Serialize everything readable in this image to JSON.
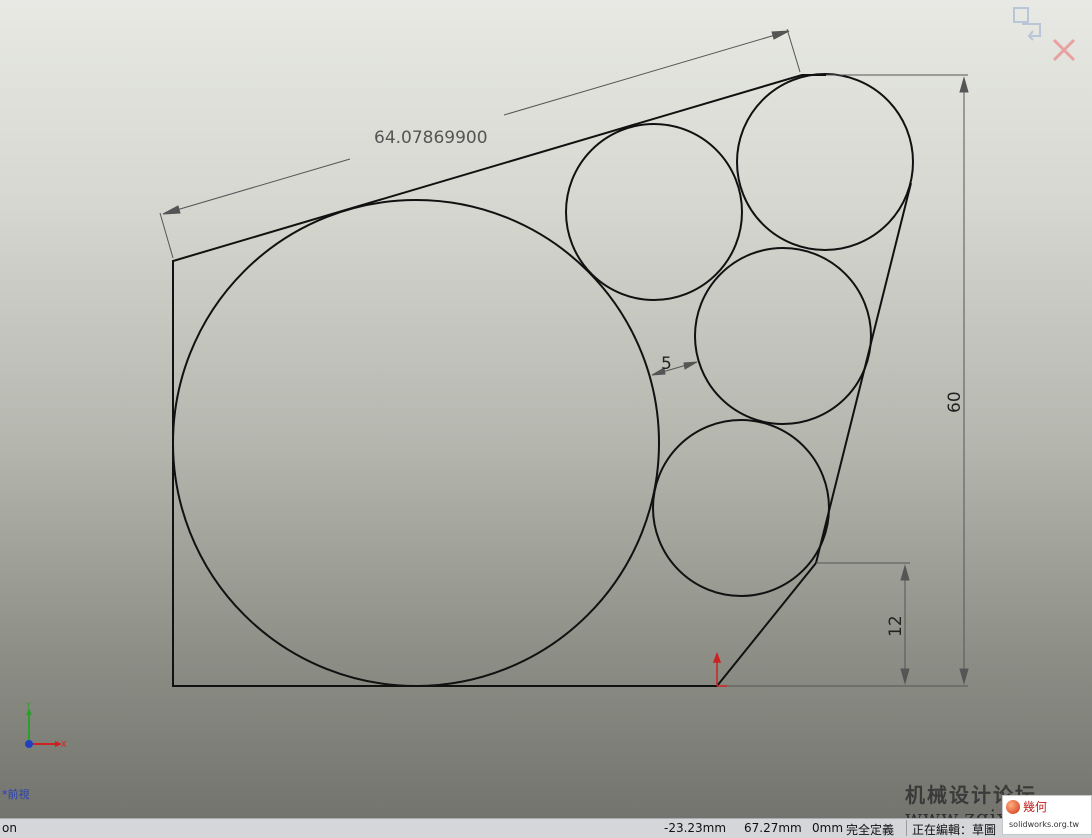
{
  "dimensions": {
    "slanted_length": "64.07869900",
    "gap": "5",
    "total_height": "60",
    "lower_height": "12"
  },
  "view": {
    "label": "*前視"
  },
  "status_bar": {
    "left_fragment": "on",
    "x_coord": "-23.23mm",
    "y_coord": "67.27mm",
    "z_coord": "0mm",
    "sketch_state": "完全定義",
    "editing": "正在編輯：草圖"
  },
  "watermark": {
    "forum_name": "机械设计论坛",
    "forum_url": "www.zgjxcad.com",
    "badge_title": "幾何",
    "badge_url": "solidworks.org.tw"
  },
  "icons": {
    "confirm": "confirm-sketch-icon",
    "cancel": "cancel-sketch-icon",
    "triad": "axis-triad-icon",
    "origin": "sketch-origin-icon"
  },
  "colors": {
    "sketch_line": "#111111",
    "dimension_line": "#555555",
    "origin": "#cc2222",
    "statusbar_bg": "#d4d6da"
  }
}
